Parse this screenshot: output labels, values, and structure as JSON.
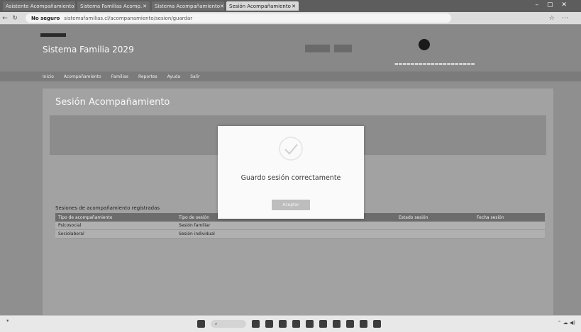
{
  "browser": {
    "tabs": [
      {
        "label": "Asistente Acompañamiento",
        "active": false
      },
      {
        "label": "Sistema Familias Acomp.",
        "active": false
      },
      {
        "label": "Sistema Acompañamiento",
        "active": false
      },
      {
        "label": "Sesión Acompañamiento",
        "active": true
      }
    ],
    "url_secure": "No seguro",
    "url": "sistemafamilias.cl/acompanamiento/sesion/guardar"
  },
  "site": {
    "title": "Sistema Familia 2029",
    "menu": [
      "Inicio",
      "Acompañamiento",
      "Familias",
      "Reportes",
      "Ayuda",
      "Salir"
    ]
  },
  "content": {
    "session_title": "Sesión Acompañamiento",
    "table_title": "Sesiones de acompañamiento registradas",
    "table_headers": [
      "Tipo de acompañamiento",
      "Tipo de sesión",
      "Estado sesión",
      "Fecha sesión"
    ],
    "table_rows": [
      [
        "Psicosocial",
        "Sesión familiar",
        "",
        ""
      ],
      [
        "Sociolaboral",
        "Sesión individual",
        "",
        ""
      ]
    ]
  },
  "modal": {
    "message": "Guardo sesión correctamente",
    "ok_label": "Aceptar"
  },
  "colors": {
    "modal_bg": "#fafafa",
    "overlay": "#8f8f8f",
    "button": "#bdbdbd"
  }
}
